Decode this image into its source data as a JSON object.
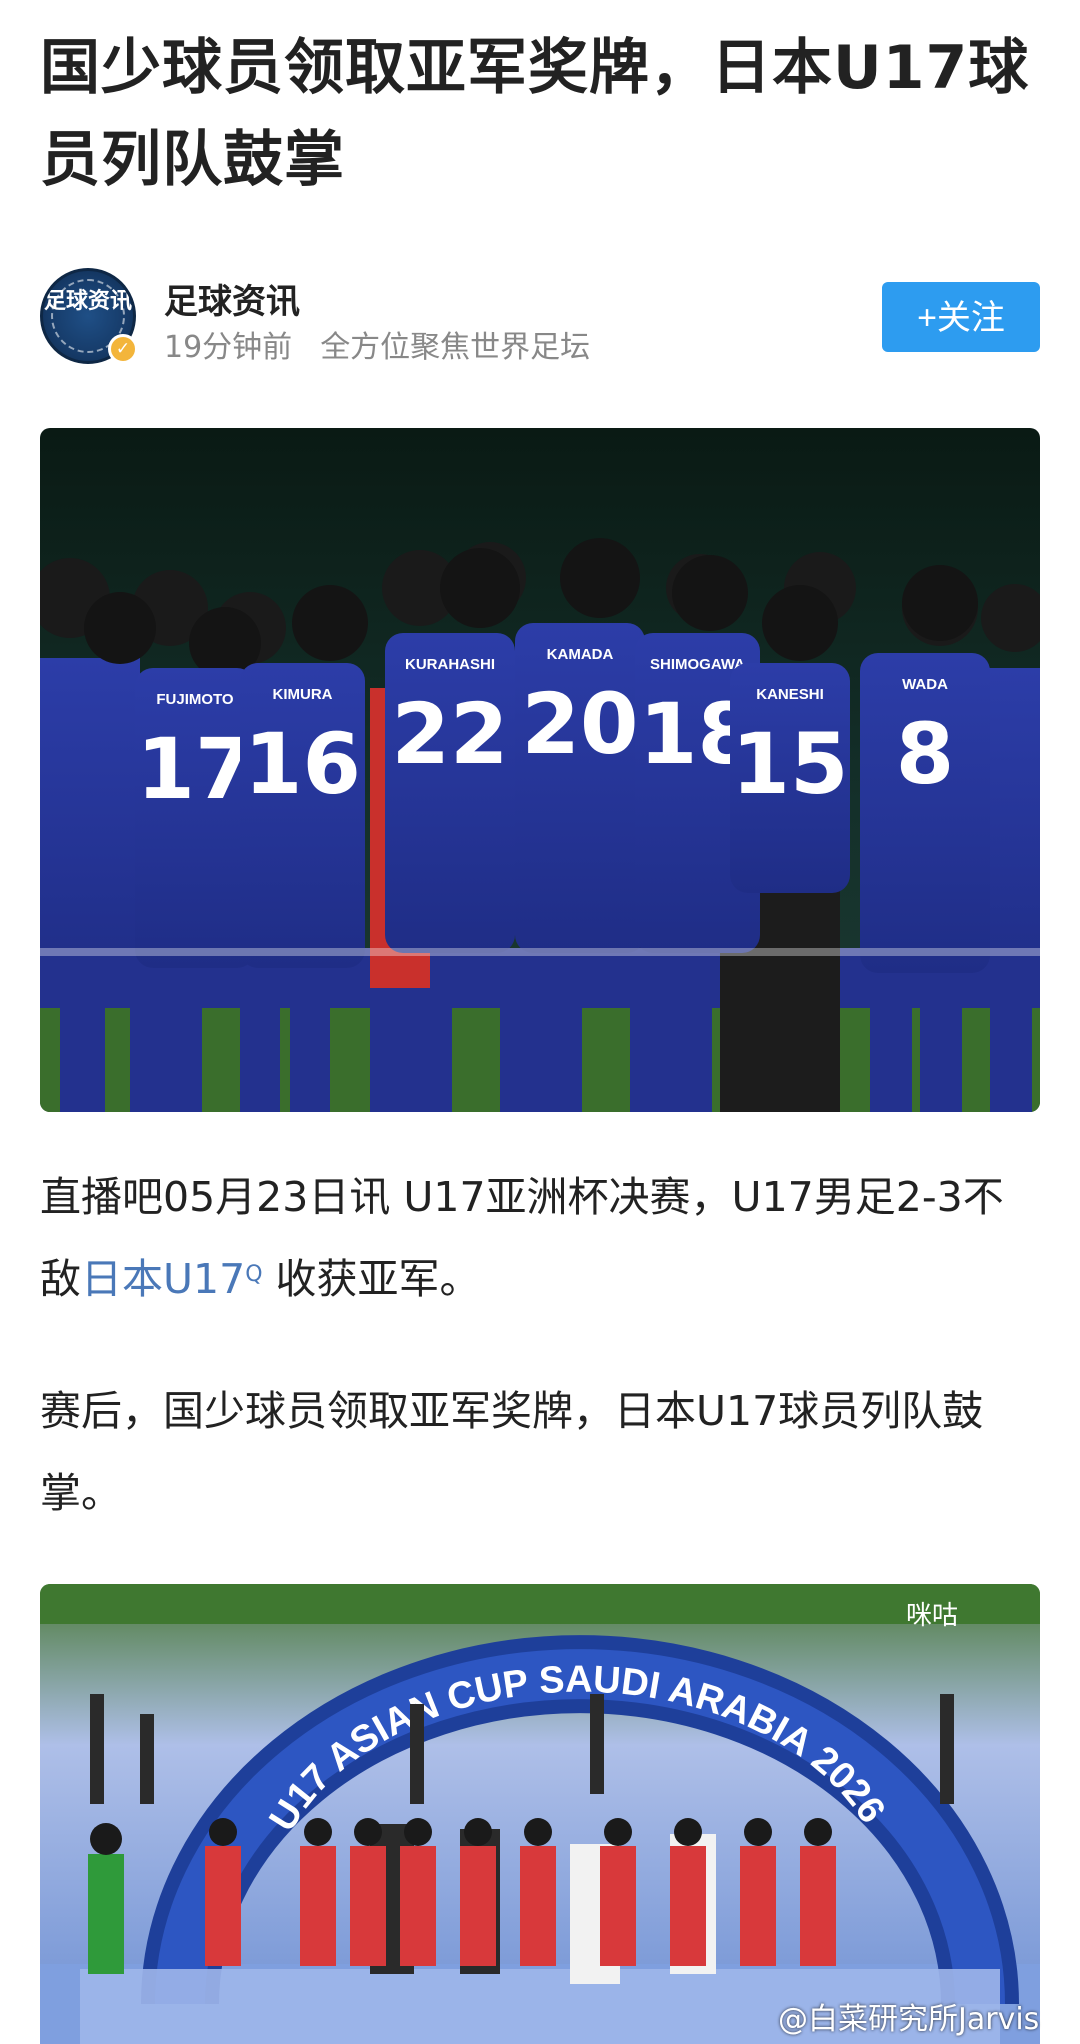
{
  "article": {
    "title": "国少球员领取亚军奖牌，日本U17球员列队鼓掌"
  },
  "author": {
    "name": "足球资讯",
    "avatar_text": "足球资讯",
    "time": "19分钟前",
    "tagline": "全方位聚焦世界足坛",
    "follow_label": "+关注",
    "verified_icon": "check-badge-icon"
  },
  "photo1": {
    "jersey_numbers": [
      "17",
      "16",
      "22",
      "20",
      "18",
      "15",
      "8"
    ],
    "jersey_names": [
      "FUJIMOTO",
      "KIMURA",
      "KURAHASHI",
      "KAMADA",
      "SHIMOGAWA",
      "KANESHI",
      "WADA"
    ]
  },
  "body": {
    "p1_before": "直播吧05月23日讯 U17亚洲杯决赛，U17男足2-3不敌",
    "p1_link": "日本U17",
    "p1_after": " 收获亚军。",
    "p2": "赛后，国少球员领取亚军奖牌，日本U17球员列队鼓掌。"
  },
  "photo2": {
    "arch_text": "U17 ASIAN CUP SAUDI ARABIA 2026",
    "broadcast_logo": "咪咕",
    "watermark": "@白菜研究所Jarvis"
  },
  "colors": {
    "follow_button": "#2d9cf0",
    "link": "#4a78b8",
    "jersey": "#2a3a9e",
    "pitch": "#3d7a2e"
  }
}
